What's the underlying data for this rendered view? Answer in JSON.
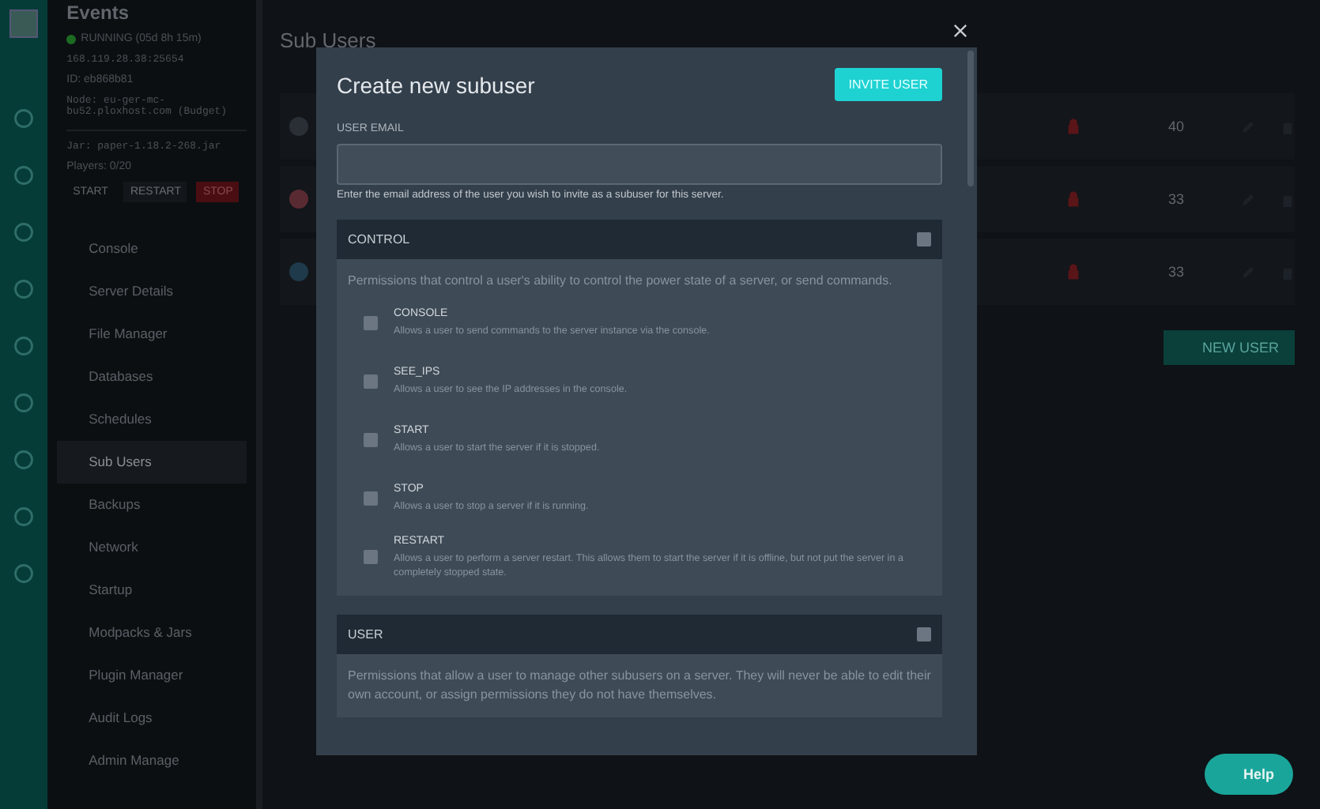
{
  "server": {
    "name": "Events",
    "status": "RUNNING",
    "uptime": "(05d 8h 15m)",
    "address": "168.119.28.38:25654",
    "id": "ID: eb868b81",
    "node": "Node: eu-ger-mc-bu52.ploxhost.com (Budget)",
    "jar": "Jar: paper-1.18.2-268.jar",
    "players": "Players: 0/20"
  },
  "power_buttons": [
    {
      "label": "START",
      "kind": "start"
    },
    {
      "label": "RESTART",
      "kind": "restart"
    },
    {
      "label": "STOP",
      "kind": "stop"
    }
  ],
  "nav": [
    {
      "label": "Console",
      "selected": false
    },
    {
      "label": "Server Details",
      "selected": false
    },
    {
      "label": "File Manager",
      "selected": false
    },
    {
      "label": "Databases",
      "selected": false
    },
    {
      "label": "Schedules",
      "selected": false
    },
    {
      "label": "Sub Users",
      "selected": true
    },
    {
      "label": "Backups",
      "selected": false
    },
    {
      "label": "Network",
      "selected": false
    },
    {
      "label": "Startup",
      "selected": false
    },
    {
      "label": "Modpacks & Jars",
      "selected": false
    },
    {
      "label": "Plugin Manager",
      "selected": false
    },
    {
      "label": "Audit Logs",
      "selected": false
    },
    {
      "label": "Admin Manage",
      "selected": false
    }
  ],
  "page": {
    "title": "Sub Users",
    "new_user": "NEW USER"
  },
  "subusers": [
    {
      "count": "40",
      "color": "#2a2f36"
    },
    {
      "count": "33",
      "color": "#5a2a33"
    },
    {
      "count": "33",
      "color": "#1f3a4a"
    }
  ],
  "modal": {
    "title": "Create new subuser",
    "invite": "INVITE USER",
    "email_label": "USER EMAIL",
    "email_help": "Enter the email address of the user you wish to invite as a subuser for this server.",
    "sections": [
      {
        "title": "CONTROL",
        "checked": false,
        "description": "Permissions that control a user's ability to control the power state of a server, or send commands.",
        "permissions": [
          {
            "name": "CONSOLE",
            "checked": false,
            "description": "Allows a user to send commands to the server instance via the console."
          },
          {
            "name": "SEE_IPS",
            "checked": false,
            "description": "Allows a user to see the IP addresses in the console."
          },
          {
            "name": "START",
            "checked": false,
            "description": "Allows a user to start the server if it is stopped."
          },
          {
            "name": "STOP",
            "checked": false,
            "description": "Allows a user to stop a server if it is running."
          },
          {
            "name": "RESTART",
            "checked": false,
            "description": "Allows a user to perform a server restart. This allows them to start the server if it is offline, but not put the server in a completely stopped state."
          }
        ]
      },
      {
        "title": "USER",
        "checked": false,
        "description": "Permissions that allow a user to manage other subusers on a server. They will never be able to edit their own account, or assign permissions they do not have themselves."
      }
    ]
  },
  "help": "Help"
}
